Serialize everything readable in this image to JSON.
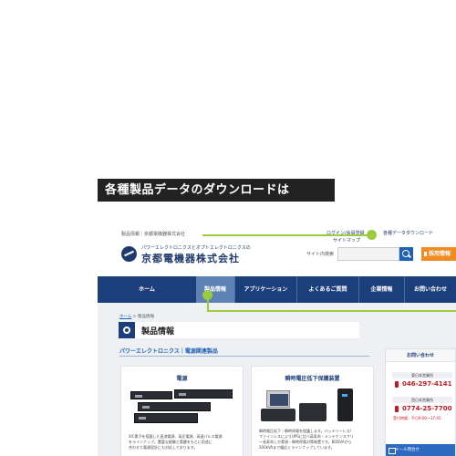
{
  "banner": {
    "text": "各種製品データのダウンロードは"
  },
  "header": {
    "tagline": "製品情報｜京都電機器株式会社",
    "logo_sub": "パワーエレクトロニクスとオプトエレクトロニクスの",
    "logo_main": "京都電機器株式会社",
    "login_link": "ログイン/会員登録",
    "sitemap_link": "サイトマップ",
    "top_link3": "各種データダウンロード",
    "search_label": "サイト内検索",
    "search_placeholder": "",
    "recruit_button": "採用情報"
  },
  "nav": {
    "items": [
      {
        "label": "ホーム",
        "active": false
      },
      {
        "label": "製品情報",
        "active": true
      },
      {
        "label": "アプリケーション",
        "active": false
      },
      {
        "label": "よくあるご質問",
        "active": false
      },
      {
        "label": "企業情報",
        "active": false
      },
      {
        "label": "お問い合わせ",
        "active": false
      }
    ]
  },
  "breadcrumb": {
    "home": "ホーム",
    "separator": " > ",
    "current": "製品情報"
  },
  "page": {
    "title": "製品情報",
    "section": "パワーエレクトロニクス｜電源関連製品"
  },
  "cards": [
    {
      "title": "電源",
      "desc_lines": [
        "SIC素子を搭載した直流電源、高圧電源、高速パルス電源",
        "をラインナップ。豊富な経験と実績をもとに用途に",
        "合わせた電源設計にも対応しております。"
      ]
    },
    {
      "title": "瞬時電圧低下保護装置",
      "desc_lines": [
        "瞬時電圧低下｜瞬時停電を保護します。バッテリーレス/",
        "ファインレスによりUPSに比べ高寿命・メンテナンスフリ",
        "ー長寿命しか実現・瞬時停電対策装置です。BODVAから",
        "200kVAまで幅広くラインナップしています。"
      ]
    }
  ],
  "sidebar": {
    "title": "お問い合わせ",
    "offices": [
      {
        "name": "東日本営業所",
        "phone": "046-297-4141"
      },
      {
        "name": "西日本営業所",
        "phone": "0774-25-7700"
      }
    ],
    "hours": "受付時間：平日9:00〜17:45",
    "mail_button": "メール問合せ"
  },
  "colors": {
    "nav_bg": "#1c3f7b",
    "nav_active": "#5f82b5",
    "accent_green": "#9ccc3c",
    "recruit_orange": "#f08c23",
    "phone_red": "#c31a22",
    "link_blue": "#1e62b5"
  },
  "icons": {
    "logo": "company-logo-mark",
    "search": "search-icon",
    "page_head": "gear-icon",
    "recruit": "document-icon",
    "phone": "phone-icon",
    "mail": "mail-icon"
  }
}
